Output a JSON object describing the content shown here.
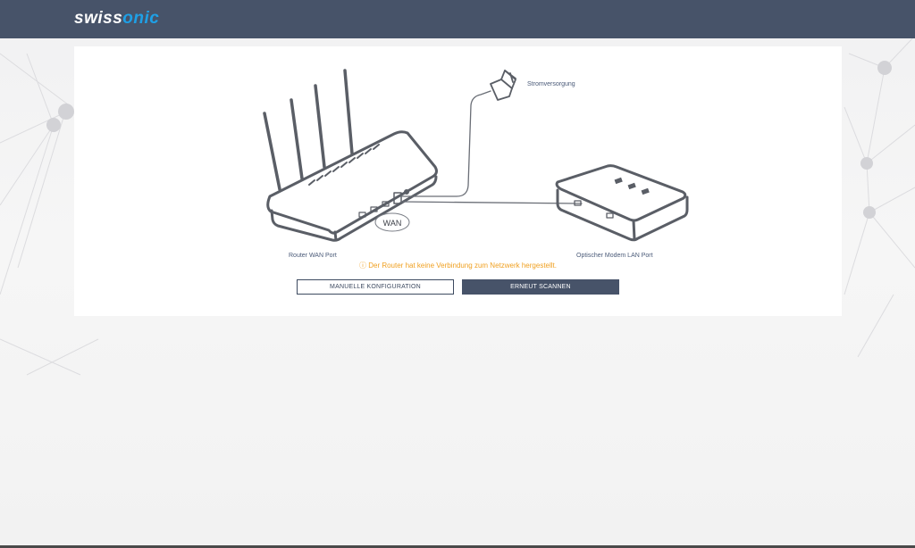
{
  "header": {
    "logo_part1": "swiss",
    "logo_part2": "onic"
  },
  "diagram": {
    "power_label": "Stromversorgung",
    "wan_badge": "WAN",
    "router_label": "Router WAN Port",
    "modem_label": "Optischer Modem LAN Port"
  },
  "status": {
    "warning_text": "ⓘ Der Router hat keine Verbindung zum Netzwerk hergestellt."
  },
  "actions": {
    "manual_label": "MANUELLE KONFIGURATION",
    "rescan_label": "ERNEUT SCANNEN"
  },
  "colors": {
    "header_bg": "#475369",
    "logo_accent": "#1ea0e6",
    "warning": "#f0a020"
  }
}
